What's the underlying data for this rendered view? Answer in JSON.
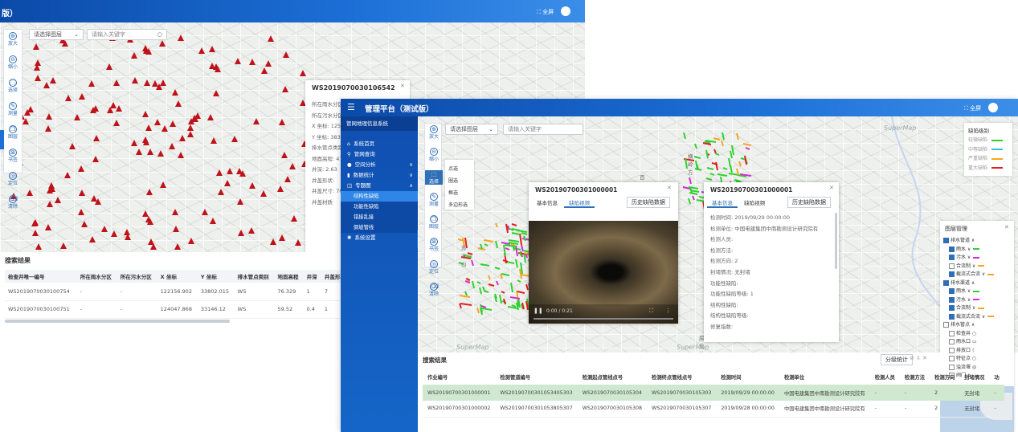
{
  "back_window": {
    "title_partial": "版）",
    "fullscreen_label": "⛶ 全屏",
    "select_layer": "请选择图层",
    "keyword_placeholder": "请输入关键字",
    "tools": [
      "放大",
      "缩小",
      "选择",
      "测量",
      "图层",
      "书签",
      "定位",
      "清除"
    ],
    "popup": {
      "title": "WS2019070030106542",
      "fields": [
        "所在雨水分区",
        "所在污水分区",
        "X 坐标: 125",
        "Y 坐标: 3834",
        "排水管点类别",
        "地面高程: 47",
        "井深: 2.63",
        "井盖形状: ",
        "井盖尺寸: 70",
        "井盖材质"
      ]
    },
    "results": {
      "title": "搜索结果",
      "headers": [
        "检查井唯一编号",
        "所在雨水分区",
        "所在污水分区",
        "X 坐标",
        "Y 坐标",
        "排水管点类别",
        "地面高程",
        "井深",
        "井盖形状"
      ],
      "rows": [
        [
          "WS2019070030100754",
          "-",
          "-",
          "122156.902",
          "33802.015",
          "WS",
          "76.329",
          "1",
          "7"
        ],
        [
          "WS2019070030100751",
          "-",
          "-",
          "124047.868",
          "33146.12",
          "WS",
          "59.52",
          "0.4",
          "1"
        ]
      ]
    }
  },
  "front_window": {
    "title": "管理平台（测试版）",
    "fullscreen_label": "⛶ 全屏",
    "system_name": "管网地理信息系统",
    "menu": [
      {
        "label": "系统首页",
        "icon": "home-icon"
      },
      {
        "label": "管网查询",
        "icon": "search-icon"
      },
      {
        "label": "空间分析",
        "icon": "globe-icon"
      },
      {
        "label": "数据统计",
        "icon": "bar-chart-icon"
      },
      {
        "label": "专题图",
        "icon": "map-icon"
      }
    ],
    "submenu": [
      "结构性缺陷",
      "功能性缺陷",
      "错接乱接",
      "倒坡管线"
    ],
    "menu_last": "系统设置",
    "select_layer": "请选择图层",
    "keyword_placeholder": "请输入关键字",
    "tools": [
      "放大",
      "缩小",
      "选择",
      "测量",
      "图层",
      "书签",
      "定位",
      "清除"
    ],
    "select_sub": [
      "点选",
      "圈选",
      "框选",
      "多边形选"
    ],
    "supermap": "SuperMap",
    "place_labels": [
      "横岭方",
      "百兰路",
      "科技园",
      "南山",
      "珠歌路",
      "坂田路",
      "苏木山",
      "房业坊",
      "环坊"
    ],
    "legend": {
      "title": "缺陷级别",
      "items": [
        {
          "label": "轻微缺陷",
          "color": "#2fd12f"
        },
        {
          "label": "中等缺陷",
          "color": "#2ec4d6"
        },
        {
          "label": "严重缺陷",
          "color": "#f5a623"
        },
        {
          "label": "重大缺陷",
          "color": "#e02020"
        }
      ]
    },
    "video_popup": {
      "title": "WS20190700301000001",
      "tabs": [
        "基本信息",
        "缺陷视频"
      ],
      "history_btn": "历史缺陷数据",
      "time": "0:00 / 0:21"
    },
    "info_popup": {
      "title": "WS20190700301000001",
      "tabs": [
        "基本信息",
        "缺陷视频"
      ],
      "history_btn": "历史缺陷数据",
      "fields": [
        "检测时间: 2019/09/29 00:00:00",
        "检测单位: 中国电建集团中南勘测设计研究院有",
        "检测人员:",
        "检测方法:",
        "检测方向: 2",
        "封堵情况: 无封堵",
        "功能性缺陷:",
        "功能性缺陷等级: 1",
        "结构性缺陷:",
        "结构性缺陷等级:",
        "修复指数:"
      ]
    },
    "layer_panel": {
      "title": "图层管理",
      "items": [
        {
          "label": "排水管道 ∧",
          "level": 0,
          "checked": true,
          "swatch": ""
        },
        {
          "label": "雨水 ∨",
          "level": 1,
          "checked": true,
          "swatch": "#2fd12f"
        },
        {
          "label": "污水 ∨",
          "level": 1,
          "checked": true,
          "swatch": "#d22fd2"
        },
        {
          "label": "合流制 ∨",
          "level": 1,
          "checked": false,
          "swatch": "#f5a623"
        },
        {
          "label": "截流式合流 ∨",
          "level": 1,
          "checked": true,
          "swatch": "#f5a623"
        },
        {
          "label": "排水渠道 ∧",
          "level": 0,
          "checked": true,
          "swatch": ""
        },
        {
          "label": "雨水 ∨",
          "level": 1,
          "checked": true,
          "swatch": "#2fd12f"
        },
        {
          "label": "污水 ∨",
          "level": 1,
          "checked": true,
          "swatch": "#d22fd2"
        },
        {
          "label": "合流制 ∨",
          "level": 1,
          "checked": true,
          "swatch": "#f5a623"
        },
        {
          "label": "截流式合流 ∨",
          "level": 1,
          "checked": true,
          "swatch": "#f5a623"
        },
        {
          "label": "排水管点 ∧",
          "level": 0,
          "checked": false,
          "swatch": ""
        },
        {
          "label": "检查井 ○",
          "level": 1,
          "checked": false,
          "swatch": ""
        },
        {
          "label": "雨水口 ▭",
          "level": 1,
          "checked": false,
          "swatch": ""
        },
        {
          "label": "排放口 ☾",
          "level": 1,
          "checked": false,
          "swatch": ""
        },
        {
          "label": "特征点 ○",
          "level": 1,
          "checked": false,
          "swatch": ""
        },
        {
          "label": "溢流堰 ◎",
          "level": 1,
          "checked": false,
          "swatch": ""
        },
        {
          "label": "阀门 ⌂",
          "level": 1,
          "checked": false,
          "swatch": ""
        }
      ]
    },
    "results": {
      "title": "搜索结果",
      "stats_btn": "分级统计",
      "headers": [
        "作业编号",
        "检测管道编号",
        "检测起点管线点号",
        "检测终点管线点号",
        "检测时间",
        "检测单位",
        "检测人员",
        "检测方法",
        "检测方向",
        "封堵情况",
        "功"
      ],
      "rows": [
        [
          "WS20190700301000001",
          "WS20190700301053405303",
          "WS2019070030105304",
          "WS2019070030105303",
          "2019/09/29 00:00:00",
          "中国电建集团中南勘测设计研究院有",
          "-",
          "-",
          "2",
          "无封堵",
          "-"
        ],
        [
          "WS20190700301000002",
          "WS20190700301053805307",
          "WS2019070030105308",
          "WS2019070030105307",
          "2019/09/28 00:00:00",
          "中国电建集团中南勘测设计研究院有",
          "-",
          "-",
          "2",
          "无封堵",
          "-"
        ]
      ]
    }
  }
}
